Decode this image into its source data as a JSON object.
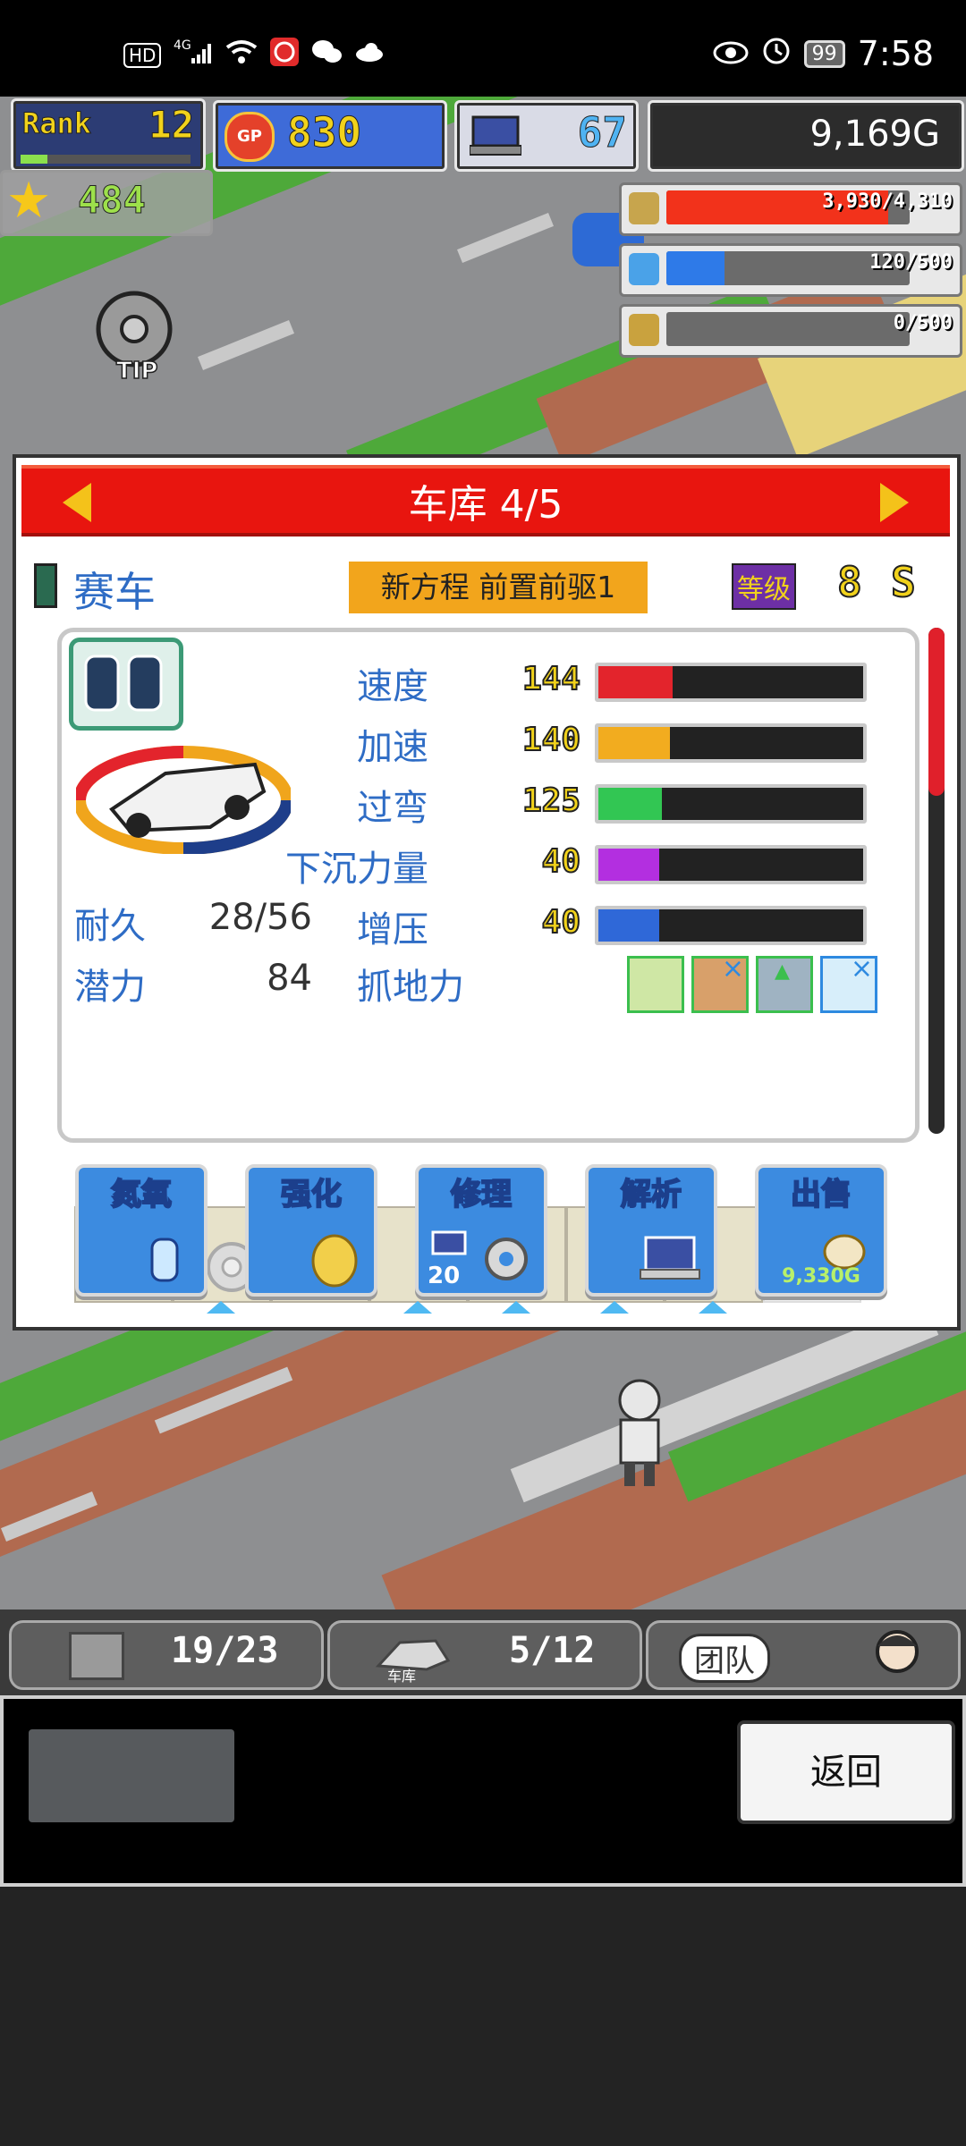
{
  "status_bar": {
    "left_items": [
      "HD",
      "4G"
    ],
    "time": "7:58",
    "battery": "99"
  },
  "hud": {
    "rank_label": "Rank",
    "rank_value": "12",
    "gp_label": "GP",
    "gp_value": "830",
    "pc_value": "67",
    "gold": "9,169G",
    "stars": "484"
  },
  "resources": [
    {
      "name": "fuel",
      "text": "3,930/4,310",
      "fill": 0.91,
      "color": "#f2321b"
    },
    {
      "name": "oil",
      "text": "120/500",
      "fill": 0.24,
      "color": "#2e7ae8"
    },
    {
      "name": "wheat",
      "text": "0/500",
      "fill": 0.0,
      "color": "#6b6b6b"
    }
  ],
  "panel": {
    "title": "车库 4/5",
    "car_type": "赛车",
    "car_name": "新方程 前置前驱1",
    "level_label": "等级",
    "level_value": "8",
    "rank_letter": "S",
    "stats": [
      {
        "label": "速度",
        "value": "144",
        "fill": 0.28,
        "color": "#e3242c"
      },
      {
        "label": "加速",
        "value": "140",
        "fill": 0.27,
        "color": "#f2ac1f"
      },
      {
        "label": "过弯",
        "value": "125",
        "fill": 0.24,
        "color": "#32c653"
      },
      {
        "label": "下沉力量",
        "value": "40",
        "fill": 0.23,
        "color": "#b32fe0"
      },
      {
        "label": "增压",
        "value": "40",
        "fill": 0.23,
        "color": "#2f68d8"
      }
    ],
    "durability_label": "耐久",
    "durability_value": "28/56",
    "potential_label": "潜力",
    "potential_value": "84",
    "grip_label": "抓地力",
    "actions": [
      {
        "label": "氮氧",
        "sub": ""
      },
      {
        "label": "强化",
        "sub": ""
      },
      {
        "label": "修理",
        "sub": "20"
      },
      {
        "label": "解析",
        "sub": ""
      },
      {
        "label": "出售",
        "sub": "9,330G"
      }
    ]
  },
  "tabs": {
    "parts": "19/23",
    "garage_label": "车库",
    "garage": "5/12",
    "team": "团队"
  },
  "footer": {
    "back": "返回"
  }
}
